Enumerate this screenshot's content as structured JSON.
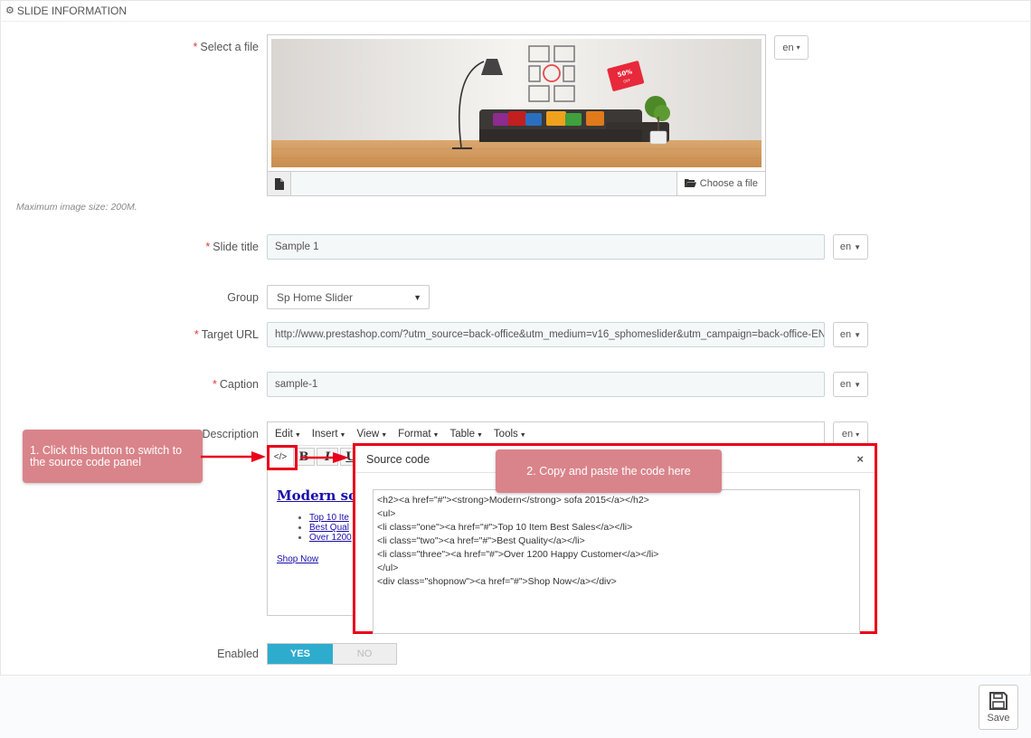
{
  "panel": {
    "title": "SLIDE INFORMATION",
    "title_icon": "cogs-icon"
  },
  "fields": {
    "select_file": {
      "label": "Select a file",
      "lang": "en",
      "choose_label": "Choose a file",
      "hint": "Maximum image size: 200M."
    },
    "slide_title": {
      "label": "Slide title",
      "value": "Sample 1",
      "lang": "en"
    },
    "group": {
      "label": "Group",
      "value": "Sp Home Slider"
    },
    "target_url": {
      "label": "Target URL",
      "value": "http://www.prestashop.com/?utm_source=back-office&utm_medium=v16_sphomeslider&utm_campaign=back-office-EN",
      "lang": "en"
    },
    "caption": {
      "label": "Caption",
      "value": "sample-1",
      "lang": "en"
    },
    "description": {
      "label": "Description",
      "lang": "en"
    },
    "enabled": {
      "label": "Enabled",
      "yes": "YES",
      "no": "NO",
      "state": "yes"
    }
  },
  "editor": {
    "menus": [
      "Edit",
      "Insert",
      "View",
      "Format",
      "Table",
      "Tools"
    ],
    "toolbar": {
      "source_icon": "</>",
      "bold": "B",
      "italic": "I",
      "underline": "U"
    },
    "preview": {
      "heading": "Modern so",
      "items": [
        "Top 10 Ite",
        "Best Qual",
        "Over 1200"
      ],
      "shop_now": "Shop Now"
    }
  },
  "modal": {
    "title": "Source code",
    "close": "×",
    "code_lines": [
      "<h2><a href=\"#\"><strong>Modern</strong> sofa 2015</a></h2>",
      "<ul>",
      "<li class=\"one\"><a href=\"#\">Top 10 Item Best Sales</a></li>",
      "<li class=\"two\"><a href=\"#\">Best Quality</a></li>",
      "<li class=\"three\"><a href=\"#\">Over 1200 Happy Customer</a></li>",
      "</ul>",
      "<div class=\"shopnow\"><a href=\"#\">Shop Now</a></div>"
    ]
  },
  "callouts": {
    "one": "1. Click this button to switch to the source code panel",
    "two": "2. Copy and paste the code here"
  },
  "banner": {
    "badge": "50%",
    "badge_sub": "OFF"
  },
  "footer": {
    "save_label": "Save"
  },
  "colors": {
    "accent": "#2eacce",
    "highlight": "#e8001c",
    "callout": "#d9848a",
    "required": "#e03a3a"
  }
}
